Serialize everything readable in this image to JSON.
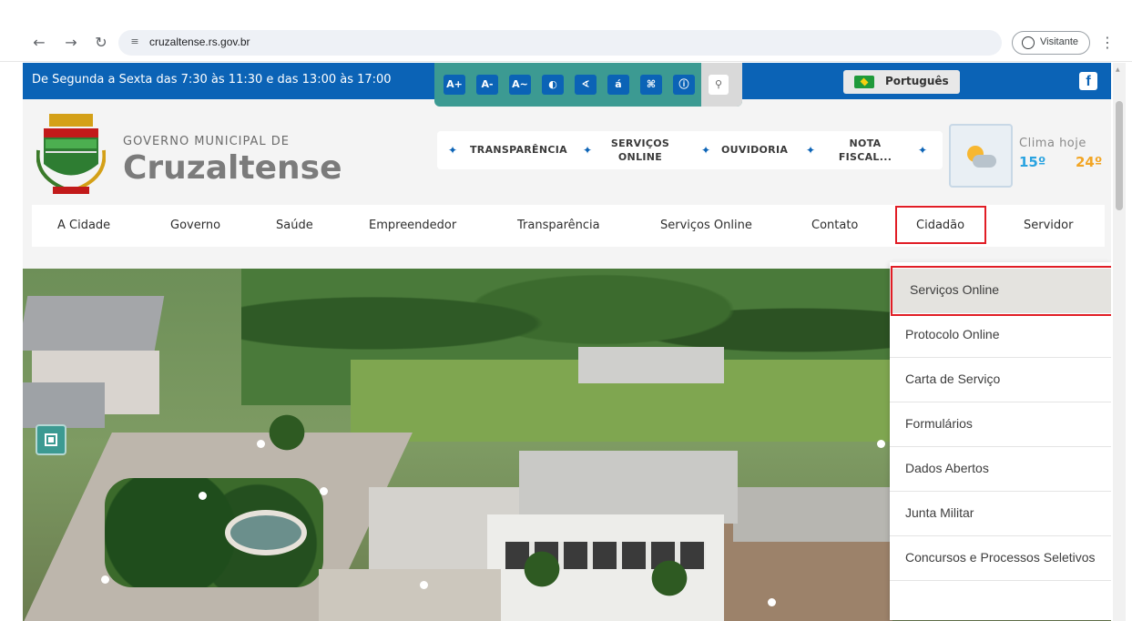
{
  "browser": {
    "url": "cruzaltense.rs.gov.br",
    "profile_label": "Visitante"
  },
  "topbar": {
    "hours": "De Segunda a Sexta das 7:30 às 11:30 e das 13:00 às 17:00",
    "accessibility_buttons": [
      "A+",
      "A-",
      "A∼",
      "◐",
      "∢",
      "á",
      "⌘",
      "ⓘ"
    ],
    "language": "Português",
    "facebook": "f"
  },
  "header": {
    "gov_subtitle": "GOVERNO MUNICIPAL DE",
    "gov_name": "Cruzaltense",
    "quick_links": [
      "TRANSPARÊNCIA",
      "SERVIÇOS ONLINE",
      "OUVIDORIA",
      "NOTA FISCAL..."
    ],
    "weather": {
      "label": "Clima hoje",
      "min": "15º",
      "max": "24º"
    }
  },
  "mainnav": {
    "items": [
      "A Cidade",
      "Governo",
      "Saúde",
      "Empreendedor",
      "Transparência",
      "Serviços Online",
      "Contato",
      "Cidadão",
      "Servidor"
    ],
    "highlighted": "Cidadão"
  },
  "dropdown": {
    "items": [
      "Serviços Online",
      "Protocolo Online",
      "Carta de Serviço",
      "Formulários",
      "Dados Abertos",
      "Junta Militar",
      "Concursos e Processos Seletivos"
    ],
    "active": "Serviços Online"
  },
  "colors": {
    "topbar": "#0b63b6",
    "accent_teal": "#3c9a92",
    "highlight_red": "#e11d25"
  }
}
